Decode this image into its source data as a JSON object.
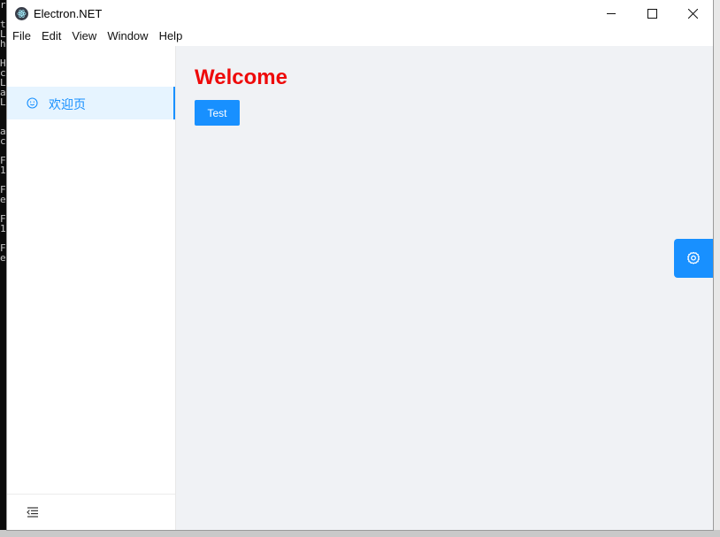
{
  "window": {
    "title": "Electron.NET",
    "controls": {
      "minimize": "—",
      "maximize": "☐",
      "close": "✕"
    }
  },
  "menu": [
    "File",
    "Edit",
    "View",
    "Window",
    "Help"
  ],
  "sidebar": {
    "items": [
      {
        "label": "欢迎页",
        "icon": "smile-icon",
        "selected": true
      }
    ],
    "footer_icon": "menu-fold-icon"
  },
  "main": {
    "heading": "Welcome",
    "button_label": "Test"
  },
  "floating_button": {
    "icon": "gear-icon"
  },
  "background_terminal": [
    "r",
    "",
    "t",
    "L",
    "h",
    "",
    "H",
    "c",
    "L",
    "a",
    "L",
    "",
    "",
    "a",
    "c",
    "",
    "F",
    "1",
    "",
    "F",
    "e",
    "",
    "F",
    "1",
    "",
    "F",
    "e"
  ],
  "colors": {
    "accent": "#1890ff",
    "heading": "#ee0a0a",
    "selected_bg": "#e6f4ff",
    "content_bg": "#f0f2f5"
  }
}
